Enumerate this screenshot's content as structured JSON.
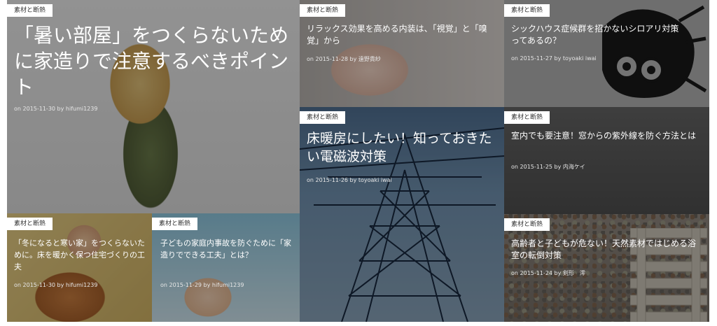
{
  "posts": [
    {
      "tag": "素材と断熱",
      "title": "「暑い部屋」をつくらないために家造りで注意するべきポイント",
      "meta": "on 2015-11-30 by hifumi1239"
    },
    {
      "tag": "素材と断熱",
      "title": "リラックス効果を高める内装は、「視覚」と「嗅覚」から",
      "meta": "on 2015-11-28 by 遠野貴紗"
    },
    {
      "tag": "素材と断熱",
      "title": "シックハウス症候群を招かないシロアリ対策ってあるの？",
      "meta": "on 2015-11-27 by toyoaki iwai"
    },
    {
      "tag": "素材と断熱",
      "title": "床暖房にしたい！知っておきたい電磁波対策",
      "meta": "on 2015-11-26 by toyoaki iwai"
    },
    {
      "tag": "素材と断熱",
      "title": "室内でも要注意！窓からの紫外線を防ぐ方法とは",
      "meta": "on 2015-11-25 by 内海ケイ"
    },
    {
      "tag": "素材と断熱",
      "title": "「冬になると寒い家」をつくらないために。床を暖かく保つ住宅づくりの工夫",
      "meta": "on 2015-11-30 by hifumi1239"
    },
    {
      "tag": "素材と断熱",
      "title": "子どもの家庭内事故を防ぐために「家造りでできる工夫」とは？",
      "meta": "on 2015-11-29 by hifumi1239"
    },
    {
      "tag": "素材と断熱",
      "title": "高齢者と子どもが危ない！天然素材ではじめる浴室の転倒対策",
      "meta": "on 2015-11-24 by 剣形　澪"
    }
  ]
}
